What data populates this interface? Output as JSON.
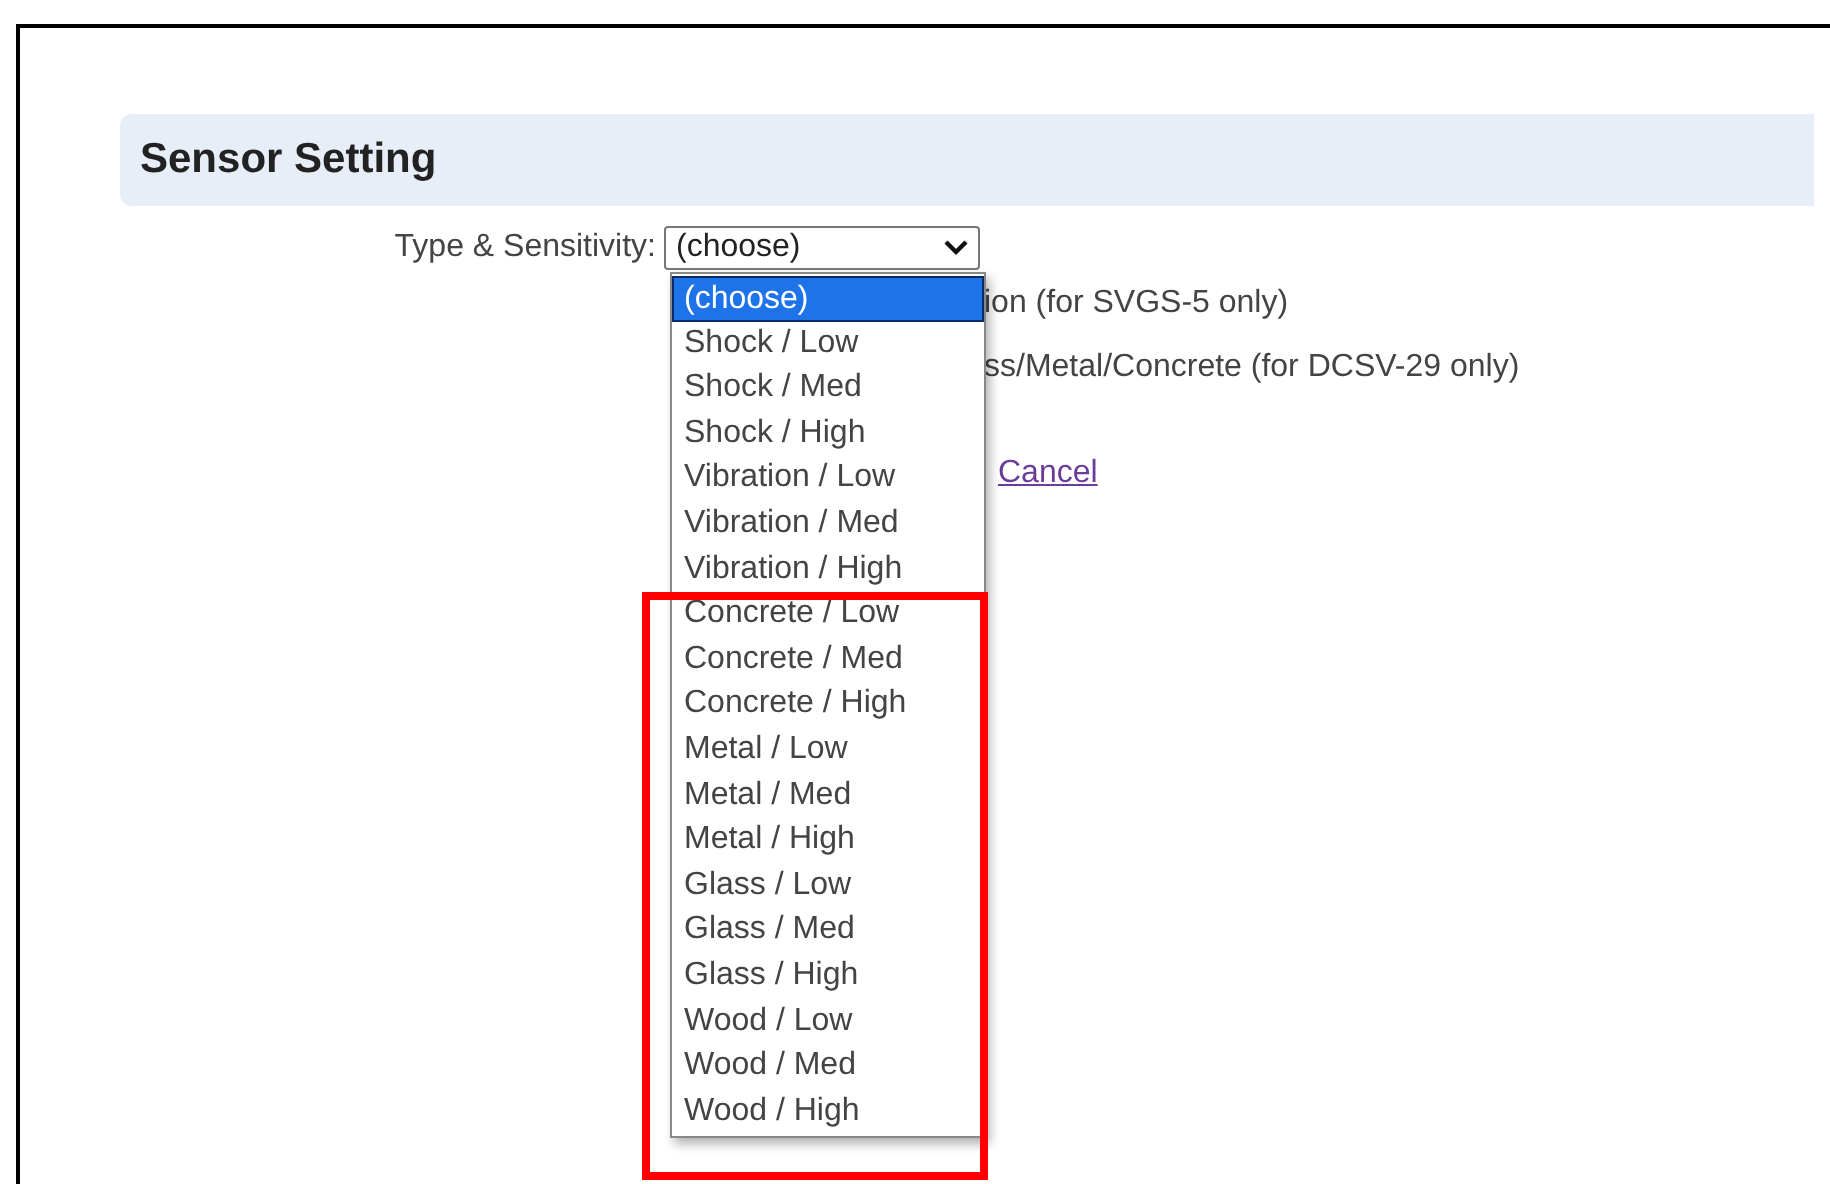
{
  "header": {
    "title": "Sensor Setting"
  },
  "type_sensitivity": {
    "label": "Type & Sensitivity:",
    "value": "(choose)",
    "expanded": true,
    "options": [
      {
        "label": "(choose)",
        "selected": true
      },
      {
        "label": "Shock / Low",
        "selected": false
      },
      {
        "label": "Shock / Med",
        "selected": false
      },
      {
        "label": "Shock / High",
        "selected": false
      },
      {
        "label": "Vibration / Low",
        "selected": false
      },
      {
        "label": "Vibration / Med",
        "selected": false
      },
      {
        "label": "Vibration / High",
        "selected": false
      },
      {
        "label": "Concrete / Low",
        "selected": false
      },
      {
        "label": "Concrete / Med",
        "selected": false
      },
      {
        "label": "Concrete / High",
        "selected": false
      },
      {
        "label": "Metal / Low",
        "selected": false
      },
      {
        "label": "Metal / Med",
        "selected": false
      },
      {
        "label": "Metal / High",
        "selected": false
      },
      {
        "label": "Glass / Low",
        "selected": false
      },
      {
        "label": "Glass / Med",
        "selected": false
      },
      {
        "label": "Glass / High",
        "selected": false
      },
      {
        "label": "Wood / Low",
        "selected": false
      },
      {
        "label": "Wood / Med",
        "selected": false
      },
      {
        "label": "Wood / High",
        "selected": false
      }
    ]
  },
  "partly_hidden_lines": [
    "ion (for SVGS-5 only)",
    "ss/Metal/Concrete (for DCSV-29 only)"
  ],
  "cancel_link": "Cancel"
}
